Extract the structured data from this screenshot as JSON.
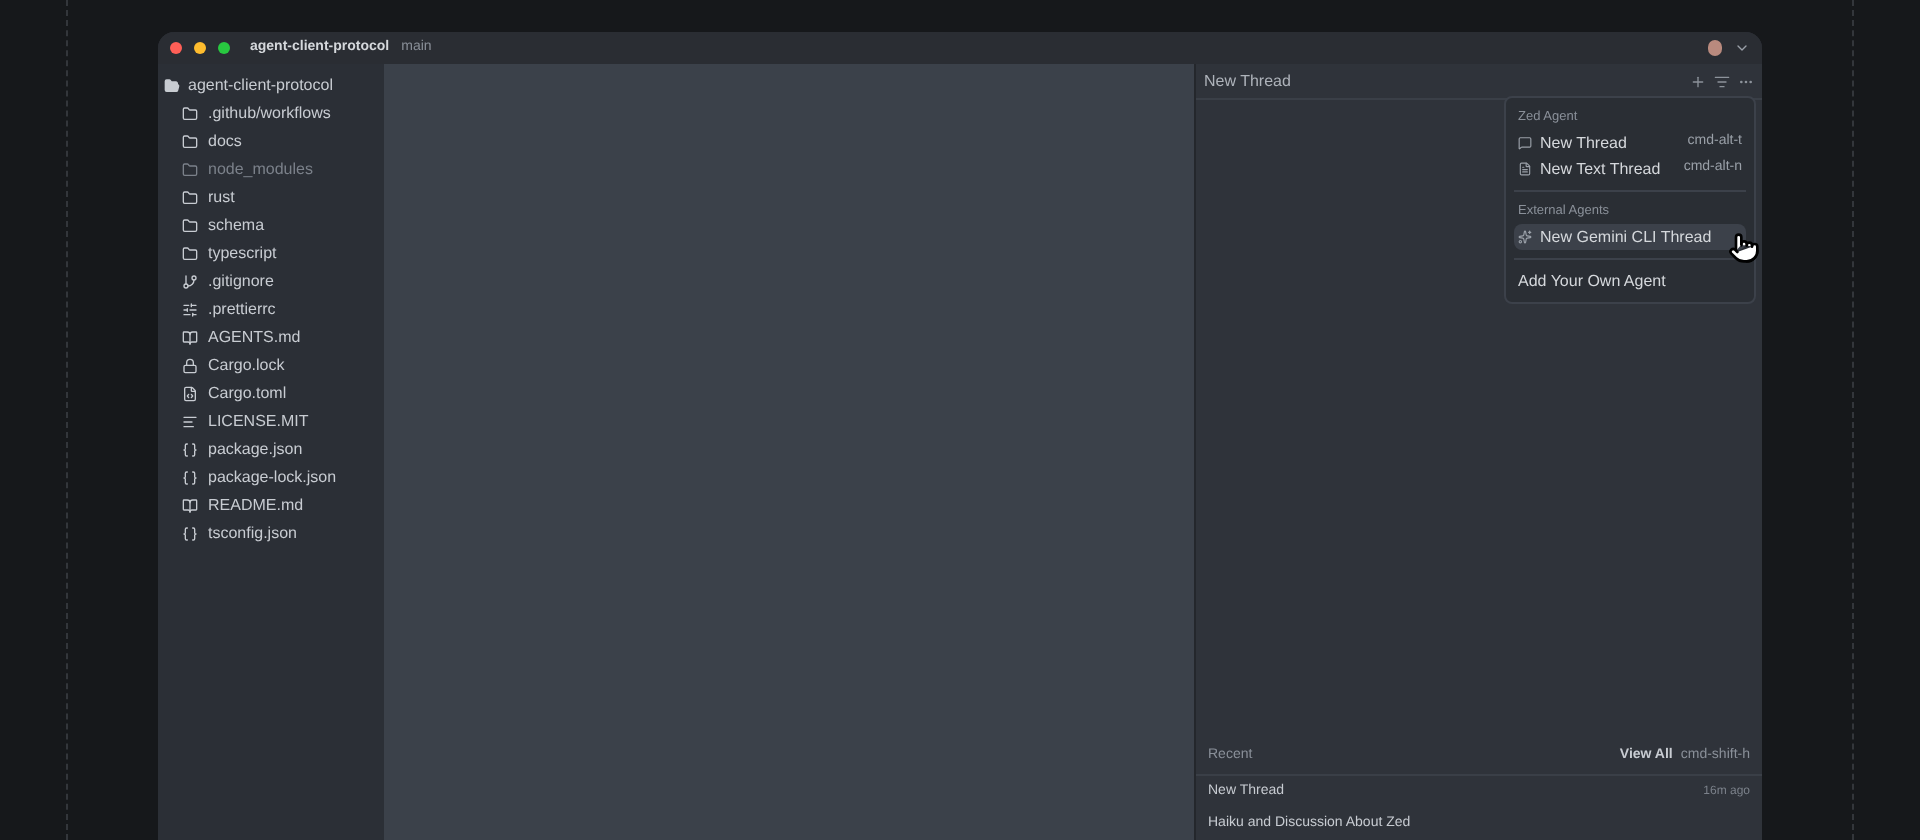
{
  "window": {
    "title": "agent-client-protocol",
    "branch": "main"
  },
  "project": {
    "name": "agent-client-protocol",
    "entries": [
      {
        "name": ".github/workflows",
        "kind": "folder",
        "ignored": false
      },
      {
        "name": "docs",
        "kind": "folder",
        "ignored": false
      },
      {
        "name": "node_modules",
        "kind": "folder",
        "ignored": true
      },
      {
        "name": "rust",
        "kind": "folder",
        "ignored": false
      },
      {
        "name": "schema",
        "kind": "folder",
        "ignored": false
      },
      {
        "name": "typescript",
        "kind": "folder",
        "ignored": false
      },
      {
        "name": ".gitignore",
        "kind": "git",
        "ignored": false
      },
      {
        "name": ".prettierrc",
        "kind": "config",
        "ignored": false
      },
      {
        "name": "AGENTS.md",
        "kind": "book",
        "ignored": false
      },
      {
        "name": "Cargo.lock",
        "kind": "lock",
        "ignored": false
      },
      {
        "name": "Cargo.toml",
        "kind": "toml",
        "ignored": false
      },
      {
        "name": "LICENSE.MIT",
        "kind": "text",
        "ignored": false
      },
      {
        "name": "package.json",
        "kind": "json",
        "ignored": false
      },
      {
        "name": "package-lock.json",
        "kind": "json",
        "ignored": false
      },
      {
        "name": "README.md",
        "kind": "book",
        "ignored": false
      },
      {
        "name": "tsconfig.json",
        "kind": "json",
        "ignored": false
      }
    ]
  },
  "agent_panel": {
    "title": "New Thread",
    "menu": {
      "sections": [
        {
          "heading": "Zed Agent",
          "items": [
            {
              "label": "New Thread",
              "shortcut": "cmd-alt-t",
              "kind": "chat",
              "selected": false
            },
            {
              "label": "New Text Thread",
              "shortcut": "cmd-alt-n",
              "kind": "text",
              "selected": false
            }
          ]
        },
        {
          "heading": "External Agents",
          "items": [
            {
              "label": "New Gemini CLI Thread",
              "kind": "sparkle",
              "selected": true
            }
          ]
        }
      ],
      "footer": "Add Your Own Agent"
    },
    "recent": {
      "heading": "Recent",
      "view_all": "View All",
      "shortcut": "cmd-shift-h",
      "threads": [
        {
          "title": "New Thread",
          "time": "16m ago"
        },
        {
          "title": "Haiku and Discussion About Zed"
        }
      ]
    }
  }
}
